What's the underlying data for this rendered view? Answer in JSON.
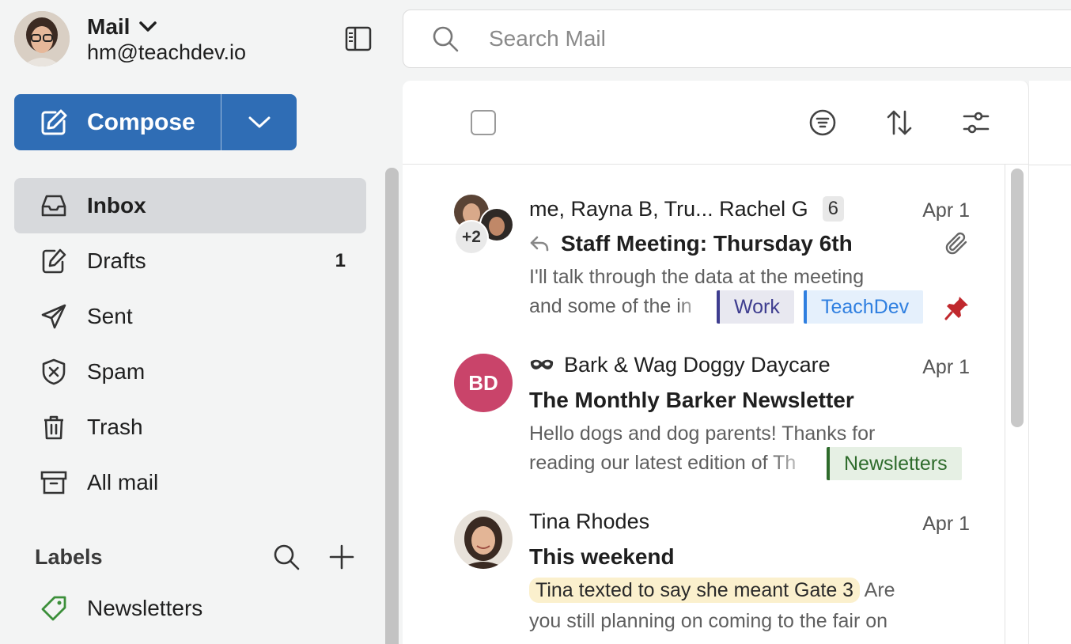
{
  "account": {
    "app_title": "Mail",
    "email": "hm@teachdev.io"
  },
  "compose": {
    "label": "Compose"
  },
  "nav": [
    {
      "label": "Inbox",
      "icon": "inbox-icon",
      "active": true
    },
    {
      "label": "Drafts",
      "icon": "drafts-icon",
      "count": "1"
    },
    {
      "label": "Sent",
      "icon": "send-icon"
    },
    {
      "label": "Spam",
      "icon": "spam-shield-icon"
    },
    {
      "label": "Trash",
      "icon": "trash-icon"
    },
    {
      "label": "All mail",
      "icon": "archive-icon"
    }
  ],
  "labels": {
    "title": "Labels",
    "items": [
      {
        "label": "Newsletters",
        "color": "#3c8f3a"
      }
    ]
  },
  "search": {
    "placeholder": "Search Mail"
  },
  "messages": [
    {
      "from": "me, Rayna B, Tru... Rachel G",
      "thread_count": "6",
      "extra_participants": "+2",
      "date": "Apr 1",
      "subject": "Staff Meeting: Thursday 6th",
      "preview_line1": "I'll talk through the data at the meeting",
      "preview_line2": "and some of the in",
      "tags": [
        {
          "label": "Work",
          "color": "#3e3d8f",
          "bg": "#e8e8f0"
        },
        {
          "label": "TeachDev",
          "color": "#2f7fe0",
          "bg": "#e5f0fc"
        }
      ]
    },
    {
      "from": "Bark & Wag Doggy Daycare",
      "avatar_initials": "BD",
      "date": "Apr 1",
      "subject": "The Monthly Barker Newsletter",
      "preview_line1": "Hello dogs and dog parents! Thanks for",
      "preview_line2": "reading our latest edition of Th",
      "tags": [
        {
          "label": "Newsletters",
          "color": "#2e6b2b",
          "bg": "#e6f0e4"
        }
      ]
    },
    {
      "from": "Tina Rhodes",
      "date": "Apr 1",
      "subject": "This weekend",
      "highlight": "Tina texted to say she meant Gate 3",
      "preview_after_highlight": "Are",
      "preview_line2": "you still planning on coming to the fair on"
    }
  ],
  "colors": {
    "accent": "#2f6db5",
    "pin": "#c0282d",
    "bd_avatar": "#c9446a"
  }
}
